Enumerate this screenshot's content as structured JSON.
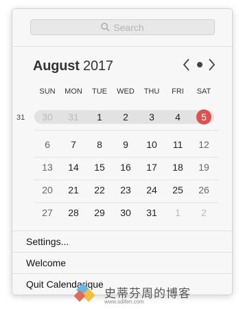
{
  "search": {
    "placeholder": "Search"
  },
  "calendar": {
    "month": "August",
    "year": "2017",
    "weekdays": [
      "SUN",
      "MON",
      "TUE",
      "WED",
      "THU",
      "FRI",
      "SAT"
    ],
    "week_number": "31",
    "weeks": [
      [
        "30",
        "31",
        "1",
        "2",
        "3",
        "4",
        "5"
      ],
      [
        "6",
        "7",
        "8",
        "9",
        "10",
        "11",
        "12"
      ],
      [
        "13",
        "14",
        "15",
        "16",
        "17",
        "18",
        "19"
      ],
      [
        "20",
        "21",
        "22",
        "23",
        "24",
        "25",
        "26"
      ],
      [
        "27",
        "28",
        "29",
        "30",
        "31",
        "1",
        "2"
      ]
    ],
    "today": "5"
  },
  "menu": {
    "settings": "Settings...",
    "welcome": "Welcome",
    "quit": "Quit Calendarique"
  },
  "watermark": {
    "text": "史蒂芬周的博客",
    "url": "www.sdifen.com"
  },
  "colors": {
    "today": "#d9534f",
    "band": "#e2e2e2"
  }
}
